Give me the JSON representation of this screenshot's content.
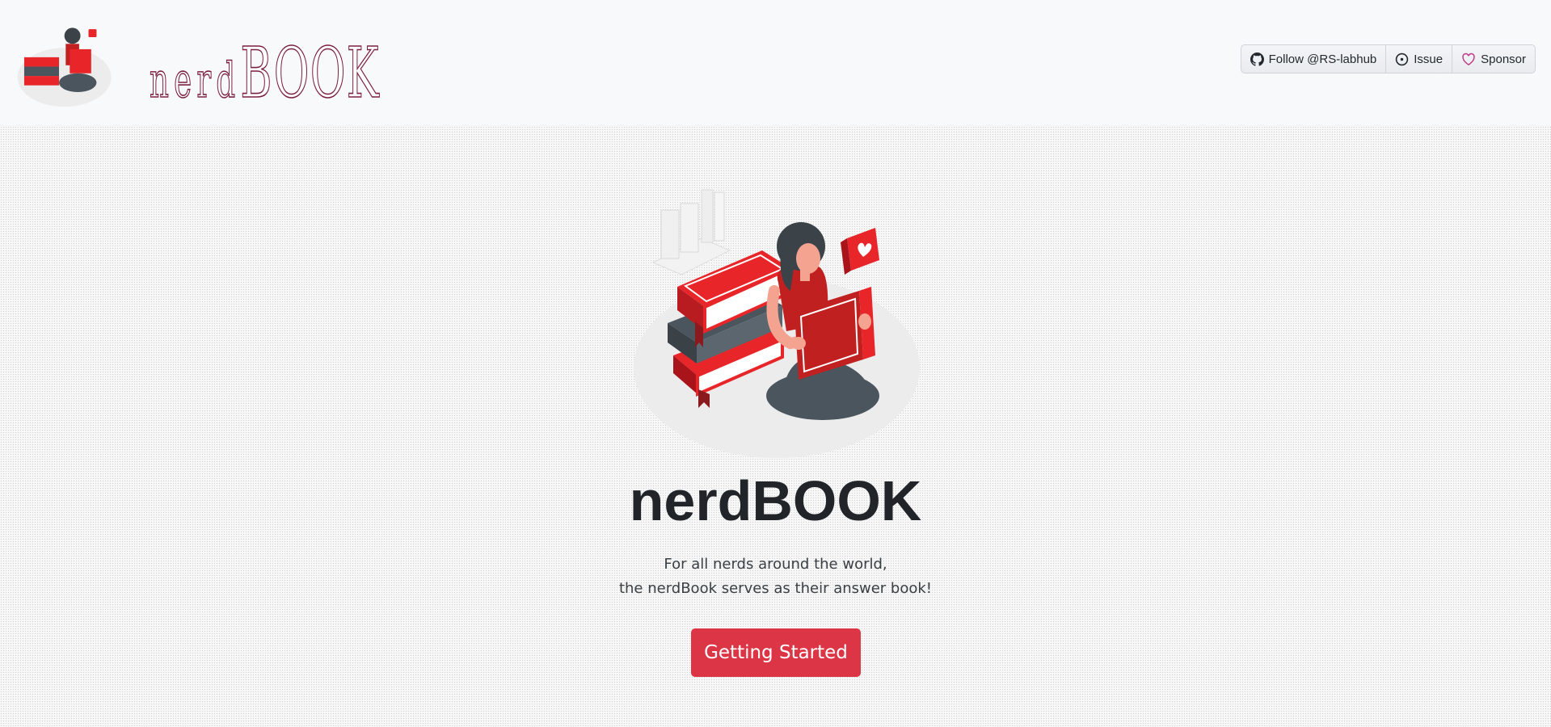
{
  "navbar": {
    "brand_small": "nerd",
    "brand_large": "BOOK",
    "buttons": {
      "follow_label": "Follow @RS-labhub",
      "issue_label": "Issue",
      "sponsor_label": "Sponsor"
    }
  },
  "hero": {
    "title": "nerdBOOK",
    "subtitle_line1": "For all nerds around the world,",
    "subtitle_line2": "the nerdBook serves as their answer book!",
    "cta_label": "Getting Started"
  },
  "icons": {
    "follow": "github-icon",
    "issue": "issue-opened-icon",
    "sponsor": "heart-icon",
    "logo": "girl-reading-books-illustration"
  },
  "colors": {
    "accent": "#dc3545",
    "brand_outline": "#7a2040",
    "illustration_red": "#e8262a",
    "sponsor_heart": "#bf3989"
  }
}
